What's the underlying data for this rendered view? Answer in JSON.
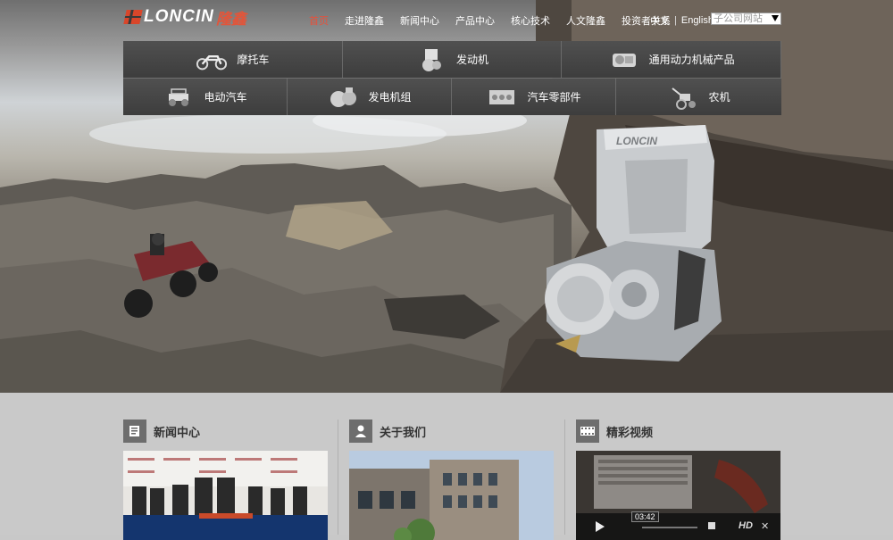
{
  "brand": {
    "logo_text": "LONCIN",
    "logo_cn": "隆鑫"
  },
  "top_nav": [
    {
      "label": "首页",
      "active": true
    },
    {
      "label": "走进隆鑫",
      "active": false
    },
    {
      "label": "新闻中心",
      "active": false
    },
    {
      "label": "产品中心",
      "active": false
    },
    {
      "label": "核心技术",
      "active": false
    },
    {
      "label": "人文隆鑫",
      "active": false
    },
    {
      "label": "投资者关系",
      "active": false
    }
  ],
  "language": {
    "chinese": "中文",
    "separator": "|",
    "english": "English"
  },
  "subsidiary_select": {
    "value": "子公司网站"
  },
  "mega_menu": {
    "row1": [
      {
        "label": "摩托车",
        "icon": "motorcycle-icon"
      },
      {
        "label": "发动机",
        "icon": "engine-icon"
      },
      {
        "label": "通用动力机械产品",
        "icon": "general-engine-icon"
      }
    ],
    "row2": [
      {
        "label": "电动汽车",
        "icon": "electric-car-icon"
      },
      {
        "label": "发电机组",
        "icon": "generator-icon"
      },
      {
        "label": "汽车零部件",
        "icon": "auto-parts-icon"
      },
      {
        "label": "农机",
        "icon": "tiller-icon"
      }
    ]
  },
  "hero": {
    "engine_brand": "LONCIN"
  },
  "sections": [
    {
      "title": "新闻中心",
      "icon": "news-icon"
    },
    {
      "title": "关于我们",
      "icon": "person-icon"
    },
    {
      "title": "精彩视频",
      "icon": "film-icon"
    }
  ],
  "video_player": {
    "time": "03:42",
    "hd_label": "HD"
  },
  "colors": {
    "accent": "#e8503a",
    "logo_red": "#d9462a",
    "menu_bg": "#3f3f3f",
    "lower_bg": "#c9c9c9"
  }
}
